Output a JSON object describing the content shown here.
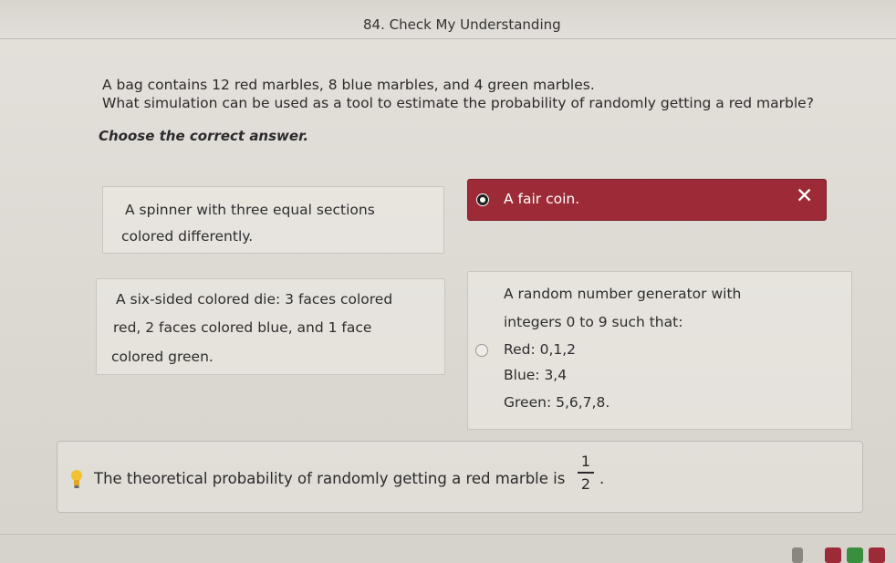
{
  "header": {
    "title": "84. Check My Understanding"
  },
  "question": {
    "line1": "A bag contains 12 red marbles, 8 blue marbles, and 4 green marbles.",
    "line2": "What simulation can be used as a tool to estimate the probability of randomly getting a red marble?",
    "instruction": "Choose the correct answer."
  },
  "options": {
    "a": {
      "lines": [
        "A spinner with three equal sections",
        "colored differently."
      ],
      "selected": false
    },
    "b": {
      "lines": [
        "A fair coin."
      ],
      "selected": true,
      "result": "incorrect"
    },
    "c": {
      "lines": [
        "A six-sided colored die: 3 faces colored",
        "red, 2 faces colored blue, and 1 face",
        "colored green."
      ],
      "selected": false
    },
    "d": {
      "lines": [
        "A random number generator with",
        "integers 0 to 9 such that:",
        "Red: 0,1,2",
        "Blue: 3,4",
        "Green: 5,6,7,8."
      ],
      "selected": false
    }
  },
  "feedback": {
    "text": "The theoretical probability of randomly getting a red marble is",
    "fraction_numerator": "1",
    "fraction_denominator": "2",
    "end": ".",
    "icon": "lightbulb-icon"
  },
  "colors": {
    "selected_incorrect": "#9d2b37",
    "page_background": "#e0ddd8",
    "text": "#2a2a2a"
  }
}
